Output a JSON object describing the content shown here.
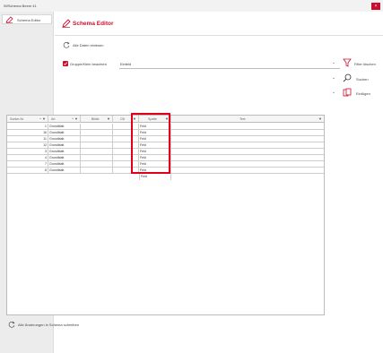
{
  "window": {
    "title": "IWSchema Beem 41",
    "close_label": "×"
  },
  "sidebar": {
    "items": [
      {
        "label": "Schema Editor"
      }
    ]
  },
  "header": {
    "title": "Schema Editor"
  },
  "actions": {
    "reload_label": "Alle Daten einlesen",
    "save_all_label": "Alle Änderungen in Schema schreiben"
  },
  "filter": {
    "checkbox_label": "Gruppe/Klein beachten",
    "checked": true,
    "select_value": "Einfeld"
  },
  "buttons": {
    "filter_clear": "Filter löschen",
    "search": "Suchen",
    "insert": "Einfügen"
  },
  "table": {
    "columns": [
      {
        "label": "Sortier-Nr.",
        "controls": "^ ▼"
      },
      {
        "label": "Art",
        "controls": "^ ▼"
      },
      {
        "label": "Bildtx",
        "controls": "▼"
      },
      {
        "label": "CB",
        "controls": "▼"
      },
      {
        "label": "Spalte",
        "controls": "▼"
      },
      {
        "label": "Text",
        "controls": "▼"
      }
    ],
    "rows": [
      {
        "nr": "1",
        "art": "Grundblatt",
        "feld": "Feld"
      },
      {
        "nr": "16",
        "art": "Grundblatt",
        "feld": "Feld"
      },
      {
        "nr": "11",
        "art": "Grundblatt",
        "feld": "Feld"
      },
      {
        "nr": "12",
        "art": "Grundblatt",
        "feld": "Feld"
      },
      {
        "nr": "3",
        "art": "Grundblatt",
        "feld": "Feld"
      },
      {
        "nr": "4",
        "art": "Grundblatt",
        "feld": "Feld"
      },
      {
        "nr": "7",
        "art": "Grundblatt",
        "feld": "Feld"
      },
      {
        "nr": "8",
        "art": "Grundblatt",
        "feld": "Feld"
      },
      {
        "nr": "",
        "art": "",
        "feld": "Feld"
      }
    ]
  },
  "colors": {
    "accent": "#c8102e",
    "highlight": "#e0001a"
  }
}
